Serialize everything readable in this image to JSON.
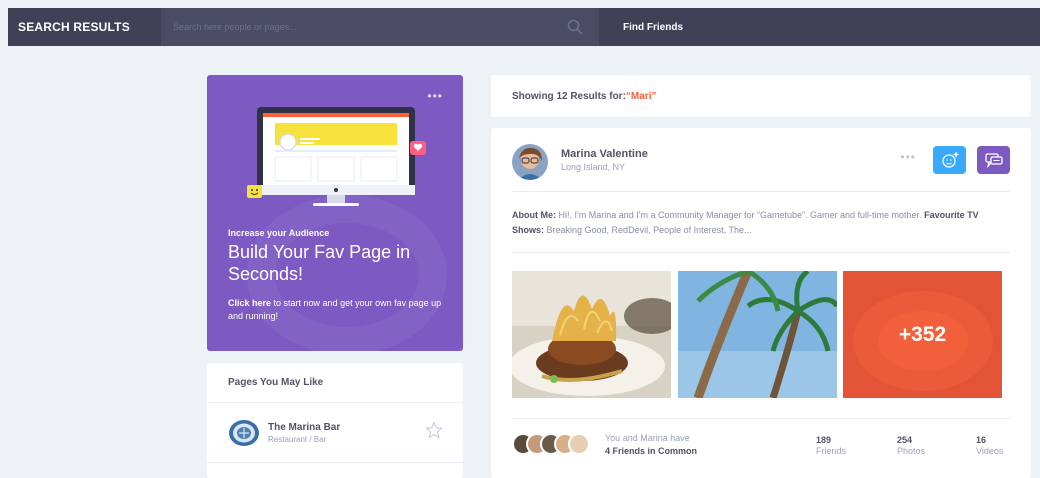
{
  "topbar": {
    "title": "SEARCH RESULTS",
    "search_placeholder": "Search here people or pages...",
    "find_friends": "Find Friends"
  },
  "promo": {
    "more": "•••",
    "kicker": "Increase your Audience",
    "headline": "Build Your Fav Page in Seconds!",
    "cta_link": "Click here",
    "cta_rest": " to start now and get your own fav page up and running!"
  },
  "pages_you_may_like": {
    "title": "Pages You May Like",
    "items": [
      {
        "name": "The Marina Bar",
        "category": "Restaurant / Bar"
      }
    ]
  },
  "results": {
    "prefix": "Showing 12 Results for: ",
    "query": "“Mari”"
  },
  "profile_card": {
    "name": "Marina Valentine",
    "location": "Long Island, NY",
    "more": "•••",
    "about_label": "About Me:",
    "about_text": " Hi!, I'm Marina and I'm a Community Manager for “Gametube”. Gamer and full-time mother. ",
    "shows_label": "Favourite TV Shows:",
    "shows_text": " Breaking Good, RedDevil, People of Interest, The...",
    "photos_more": "+352",
    "friends_line1": "You and Marina have",
    "friends_line2": "4 Friends in Common",
    "stats": [
      {
        "value": "189",
        "label": "Friends"
      },
      {
        "value": "254",
        "label": "Photos"
      },
      {
        "value": "16",
        "label": "Videos"
      }
    ]
  },
  "colors": {
    "topbar": "#3f4257",
    "search_bg": "#494c62",
    "promo": "#7c5ac2",
    "accent_orange": "#ff5e3a",
    "accent_blue": "#38a9ff",
    "accent_purple": "#7c5ac2"
  },
  "icons": {
    "search": "search-icon",
    "star": "star-icon",
    "add_friend": "add-friend-icon",
    "message": "message-icon"
  }
}
